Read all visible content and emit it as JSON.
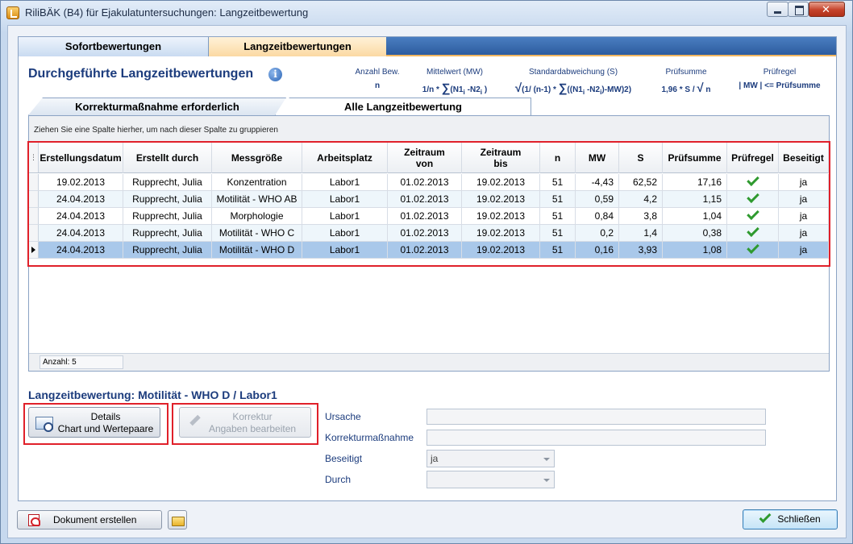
{
  "window": {
    "title": "RiliBÄK (B4) für Ejakulatuntersuchungen: Langzeitbewertung"
  },
  "main_tabs": [
    "Sofortbewertungen",
    "Langzeitbewertungen"
  ],
  "page_title": "Durchgeführte Langzeitbewertungen",
  "info_icon": "i",
  "formulas": [
    {
      "label": "Anzahl Bew.",
      "value": "n"
    },
    {
      "label": "Mittelwert (MW)",
      "value_pre": "1/n * ",
      "value_sigma": "∑",
      "value_post": "(N1",
      "sub1": "i",
      "value_mid": " -N2",
      "sub2": "i",
      "value_end": " )"
    },
    {
      "label": "Standardabweichung (S)",
      "value_root": "√",
      "value_a": "(1/ (n-1) * ",
      "value_sigma": "∑",
      "value_b": "((N1",
      "sub1": "i",
      "value_c": " -N2",
      "sub2": "i",
      "value_d": ")-MW)2)"
    },
    {
      "label": "Prüfsumme",
      "value_pre": "1,96 * S / ",
      "value_root": "√",
      "value_post": " n"
    },
    {
      "label": "Prüfregel",
      "value": "| MW |  <= Prüfsumme"
    }
  ],
  "sub_tabs": [
    "Korrekturmaßnahme erforderlich",
    "Alle Langzeitbewertung"
  ],
  "group_hint": "Ziehen Sie eine Spalte hierher, um nach dieser Spalte zu gruppieren",
  "grid": {
    "columns": [
      "Erstellungsdatum",
      "Erstellt durch",
      "Messgröße",
      "Arbeitsplatz",
      "Zeitraum\nvon",
      "Zeitraum\nbis",
      "n",
      "MW",
      "S",
      "Prüfsumme",
      "Prüfregel",
      "Beseitigt"
    ],
    "rows": [
      {
        "date": "19.02.2013",
        "by": "Rupprecht, Julia",
        "measure": "Konzentration",
        "workplace": "Labor1",
        "from": "01.02.2013",
        "to": "19.02.2013",
        "n": "51",
        "mw": "-4,43",
        "s": "62,52",
        "sum": "17,16",
        "rule_ok": true,
        "fixed": "ja"
      },
      {
        "date": "24.04.2013",
        "by": "Rupprecht, Julia",
        "measure": "Motilität - WHO AB",
        "workplace": "Labor1",
        "from": "01.02.2013",
        "to": "19.02.2013",
        "n": "51",
        "mw": "0,59",
        "s": "4,2",
        "sum": "1,15",
        "rule_ok": true,
        "fixed": "ja"
      },
      {
        "date": "24.04.2013",
        "by": "Rupprecht, Julia",
        "measure": "Morphologie",
        "workplace": "Labor1",
        "from": "01.02.2013",
        "to": "19.02.2013",
        "n": "51",
        "mw": "0,84",
        "s": "3,8",
        "sum": "1,04",
        "rule_ok": true,
        "fixed": "ja"
      },
      {
        "date": "24.04.2013",
        "by": "Rupprecht, Julia",
        "measure": "Motilität - WHO C",
        "workplace": "Labor1",
        "from": "01.02.2013",
        "to": "19.02.2013",
        "n": "51",
        "mw": "0,2",
        "s": "1,4",
        "sum": "0,38",
        "rule_ok": true,
        "fixed": "ja"
      },
      {
        "date": "24.04.2013",
        "by": "Rupprecht, Julia",
        "measure": "Motilität - WHO D",
        "workplace": "Labor1",
        "from": "01.02.2013",
        "to": "19.02.2013",
        "n": "51",
        "mw": "0,16",
        "s": "3,93",
        "sum": "1,08",
        "rule_ok": true,
        "fixed": "ja"
      }
    ],
    "selected_index": 4,
    "footer_count": "Anzahl: 5"
  },
  "detail": {
    "title": "Langzeitbewertung:  Motilität - WHO D / Labor1",
    "details_button": [
      "Details",
      "Chart und Wertepaare"
    ],
    "korrektur_button": [
      "Korrektur",
      "Angaben bearbeiten"
    ],
    "fields": {
      "ursache_label": "Ursache",
      "korrektur_label": "Korrekturmaßnahme",
      "beseitigt_label": "Beseitigt",
      "beseitigt_value": "ja",
      "durch_label": "Durch",
      "durch_value": ""
    }
  },
  "footer": {
    "document_button": "Dokument erstellen",
    "close_button": "Schließen"
  },
  "colors": {
    "accent_blue": "#1c3c7d",
    "highlight": "#e0202a",
    "selected_row": "#a9c8ea",
    "check_green": "#2f9a2f"
  }
}
